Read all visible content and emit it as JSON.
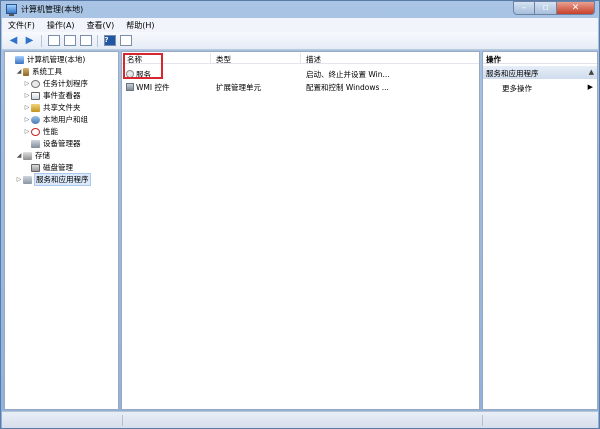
{
  "window": {
    "title": "计算机管理(本地)"
  },
  "menu": [
    "文件(F)",
    "操作(A)",
    "查看(V)",
    "帮助(H)"
  ],
  "tree": [
    {
      "label": "计算机管理(本地)",
      "icon": "computer-icon",
      "level": 0,
      "twisty": ""
    },
    {
      "label": "系统工具",
      "icon": "tools-icon",
      "level": 1,
      "twisty": "◢"
    },
    {
      "label": "任务计划程序",
      "icon": "clock-icon",
      "level": 2,
      "twisty": "▷"
    },
    {
      "label": "事件查看器",
      "icon": "event-viewer-icon",
      "level": 2,
      "twisty": "▷"
    },
    {
      "label": "共享文件夹",
      "icon": "shared-folder-icon",
      "level": 2,
      "twisty": "▷"
    },
    {
      "label": "本地用户和组",
      "icon": "users-icon",
      "level": 2,
      "twisty": "▷"
    },
    {
      "label": "性能",
      "icon": "performance-icon",
      "level": 2,
      "twisty": "▷"
    },
    {
      "label": "设备管理器",
      "icon": "device-manager-icon",
      "level": 2,
      "twisty": ""
    },
    {
      "label": "存储",
      "icon": "storage-icon",
      "level": 1,
      "twisty": "◢"
    },
    {
      "label": "磁盘管理",
      "icon": "disk-icon",
      "level": 2,
      "twisty": ""
    },
    {
      "label": "服务和应用程序",
      "icon": "services-icon",
      "level": 1,
      "twisty": "▷",
      "selected": true
    }
  ],
  "list": {
    "columns": [
      "名称",
      "类型",
      "描述"
    ],
    "rows": [
      {
        "name": "服务",
        "type": "",
        "desc": "启动、终止并设置 Win...",
        "icon": "gear-icon"
      },
      {
        "name": "WMI 控件",
        "type": "扩展管理单元",
        "desc": "配置和控制 Windows ...",
        "icon": "wmi-icon"
      }
    ]
  },
  "actions": {
    "header": "操作",
    "section": "服务和应用程序",
    "items": [
      "更多操作"
    ]
  },
  "colors": {
    "highlight": "#d7262e",
    "accent": "#2f73c8"
  }
}
